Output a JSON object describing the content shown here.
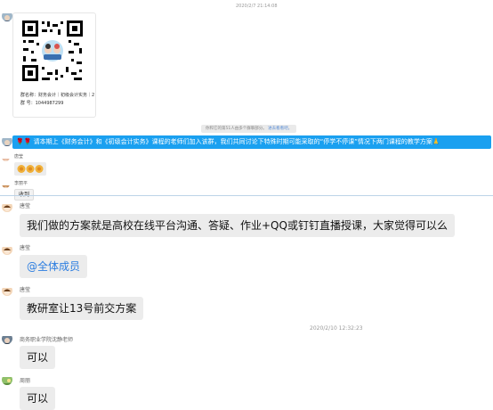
{
  "colors": {
    "announce_bg": "#1aa0f0",
    "bubble_bg": "#ececec",
    "mention": "#2b7de0",
    "divider": "#bcd3e8"
  },
  "timestamps": {
    "top": "2020/2/7 21:14:08",
    "mid": "2020/2/10 12:32:23"
  },
  "qr_card": {
    "group_name_line": "群名称：财务会计｜初级会计实务｜2",
    "group_number_line": "群    号：1044987299"
  },
  "system_notice": {
    "text": "你和它的第51人由多个群聊部分。",
    "link": "进去看看吧。"
  },
  "announcement": {
    "text": "🌹🌹 请本期上《财务会计》和《初级会计实务》课程的老师们加入该群，我们共同讨论下特殊时期可能采取的“停学不停课”情况下两门课程的教学方案🙏"
  },
  "messages": [
    {
      "sender": "唐莹",
      "text": "",
      "kind": "emoji",
      "icons": [
        "clap-icon",
        "clap-icon",
        "clap-icon"
      ]
    },
    {
      "sender": "李丽平",
      "text": "收到",
      "kind": "small"
    },
    {
      "sender": "唐莹",
      "text": "我们做的方案就是高校在线平台沟通、答疑、作业+QQ或钉钉直播授课，大家觉得可以么",
      "kind": "bubble"
    },
    {
      "sender": "唐莹",
      "mention": "@全体成员",
      "kind": "mention"
    },
    {
      "sender": "唐莹",
      "text": "教研室让13号前交方案",
      "kind": "bubble"
    },
    {
      "sender": "商务职业学院沈静老师",
      "text": "可以",
      "kind": "bubble"
    },
    {
      "sender": "周丽",
      "text": "可以",
      "kind": "bubble"
    }
  ]
}
